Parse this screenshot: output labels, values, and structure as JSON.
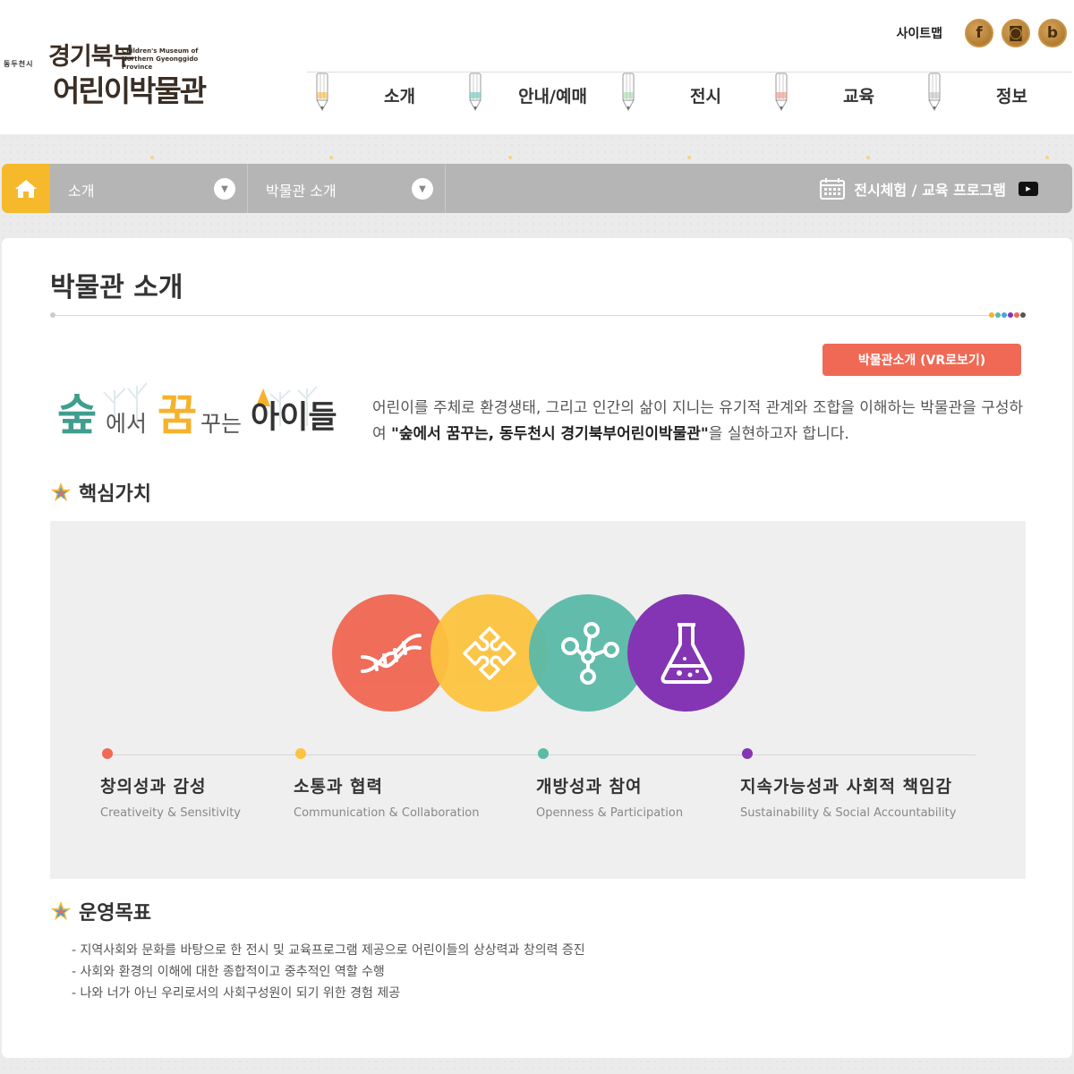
{
  "header": {
    "logo": {
      "small": "동두천시",
      "line1": "경기북부",
      "line2": "어린이박물관",
      "english": "Children's Museum of Northern Gyeonggido Province"
    },
    "sitemap": "사이트맵",
    "sns": [
      {
        "name": "facebook-icon",
        "glyph": "f"
      },
      {
        "name": "instagram-icon",
        "glyph": "◙"
      },
      {
        "name": "blog-icon",
        "glyph": "b"
      }
    ],
    "nav": [
      {
        "label": "소개",
        "color": "#f6b22b"
      },
      {
        "label": "안내/예매",
        "color": "#5bbfb0"
      },
      {
        "label": "전시",
        "color": "#9bd3a0"
      },
      {
        "label": "교육",
        "color": "#f08a78"
      },
      {
        "label": "정보",
        "color": "#bbbbbb"
      }
    ]
  },
  "breadcrumb": {
    "level1": "소개",
    "level2": "박물관 소개",
    "program": "전시체험 / 교육 프로그램",
    "home_color": "#f6b92b"
  },
  "page": {
    "title": "박물관 소개",
    "vr_button": "박물관소개 (VR로보기)",
    "slogan": {
      "p1": "숲",
      "p2": "에서",
      "p3": "꿈",
      "p4": "꾸는",
      "p5": "아이들"
    },
    "intro_before": "어린이를 주체로 환경생태, 그리고 인간의 삶이 지니는 유기적 관계와 조합을 이해하는 박물관을 구성하여 ",
    "intro_bold": "\"숲에서 꿈꾸는, 동두천시 경기북부어린이박물관\"",
    "intro_after": "을 실현하고자 합니다."
  },
  "core_values": {
    "heading": "핵심가치",
    "items": [
      {
        "kr": "창의성과 감성",
        "en": "Creativeity & Sensitivity",
        "color": "#f06955",
        "icon": "dna-icon"
      },
      {
        "kr": "소통과 협력",
        "en": "Communication & Collaboration",
        "color": "#fcc33f",
        "icon": "puzzle-icon"
      },
      {
        "kr": "개방성과 참여",
        "en": "Openness & Participation",
        "color": "#5bbaa8",
        "icon": "molecule-icon"
      },
      {
        "kr": "지속가능성과 사회적 책임감",
        "en": "Sustainability & Social Accountability",
        "color": "#8435b3",
        "icon": "flask-icon"
      }
    ]
  },
  "goals": {
    "heading": "운영목표",
    "items": [
      "지역사회와 문화를 바탕으로 한 전시 및 교육프로그램 제공으로 어린이들의 상상력과 창의력 증진",
      "사회와 환경의 이해에 대한 종합적이고 중추적인 역할 수행",
      "나와 너가 아닌 우리로서의 사회구성원이 되기 위한 경험 제공"
    ]
  }
}
